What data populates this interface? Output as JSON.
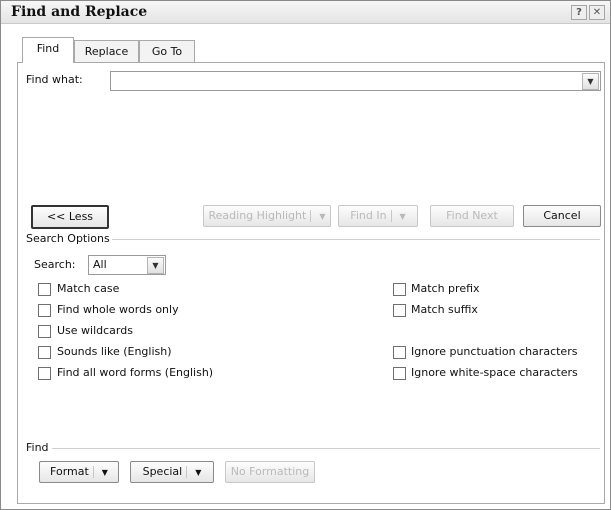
{
  "window": {
    "title": "Find and Replace",
    "help_button": "?",
    "close_button": "✕"
  },
  "tabs": [
    {
      "label": "Find",
      "active": true
    },
    {
      "label": "Replace",
      "active": false
    },
    {
      "label": "Go To",
      "active": false
    }
  ],
  "find_what": {
    "label": "Find what:",
    "value": "",
    "dropdown_icon": "chevron-down-icon"
  },
  "buttons": {
    "less": "<< Less",
    "reading_highlight": "Reading Highlight",
    "find_in": "Find In",
    "find_next": "Find Next",
    "cancel": "Cancel"
  },
  "search_options": {
    "heading": "Search Options",
    "search_label": "Search:",
    "search_value": "All"
  },
  "checkboxes_left": [
    {
      "label": "Match case",
      "checked": false
    },
    {
      "label": "Find whole words only",
      "checked": false
    },
    {
      "label": "Use wildcards",
      "checked": false
    },
    {
      "label": "Sounds like (English)",
      "checked": false
    },
    {
      "label": "Find all word forms (English)",
      "checked": false
    }
  ],
  "checkboxes_right": [
    {
      "label": "Match prefix",
      "checked": false
    },
    {
      "label": "Match suffix",
      "checked": false
    },
    {
      "label": "Ignore punctuation characters",
      "checked": false
    },
    {
      "label": "Ignore white-space characters",
      "checked": false
    }
  ],
  "find_section": {
    "heading": "Find",
    "format": "Format",
    "special": "Special",
    "no_formatting": "No Formatting"
  },
  "colors": {
    "title_bar": "#ececec",
    "disabled_text": "#b9b9b9",
    "border": "#a9a9a9"
  }
}
